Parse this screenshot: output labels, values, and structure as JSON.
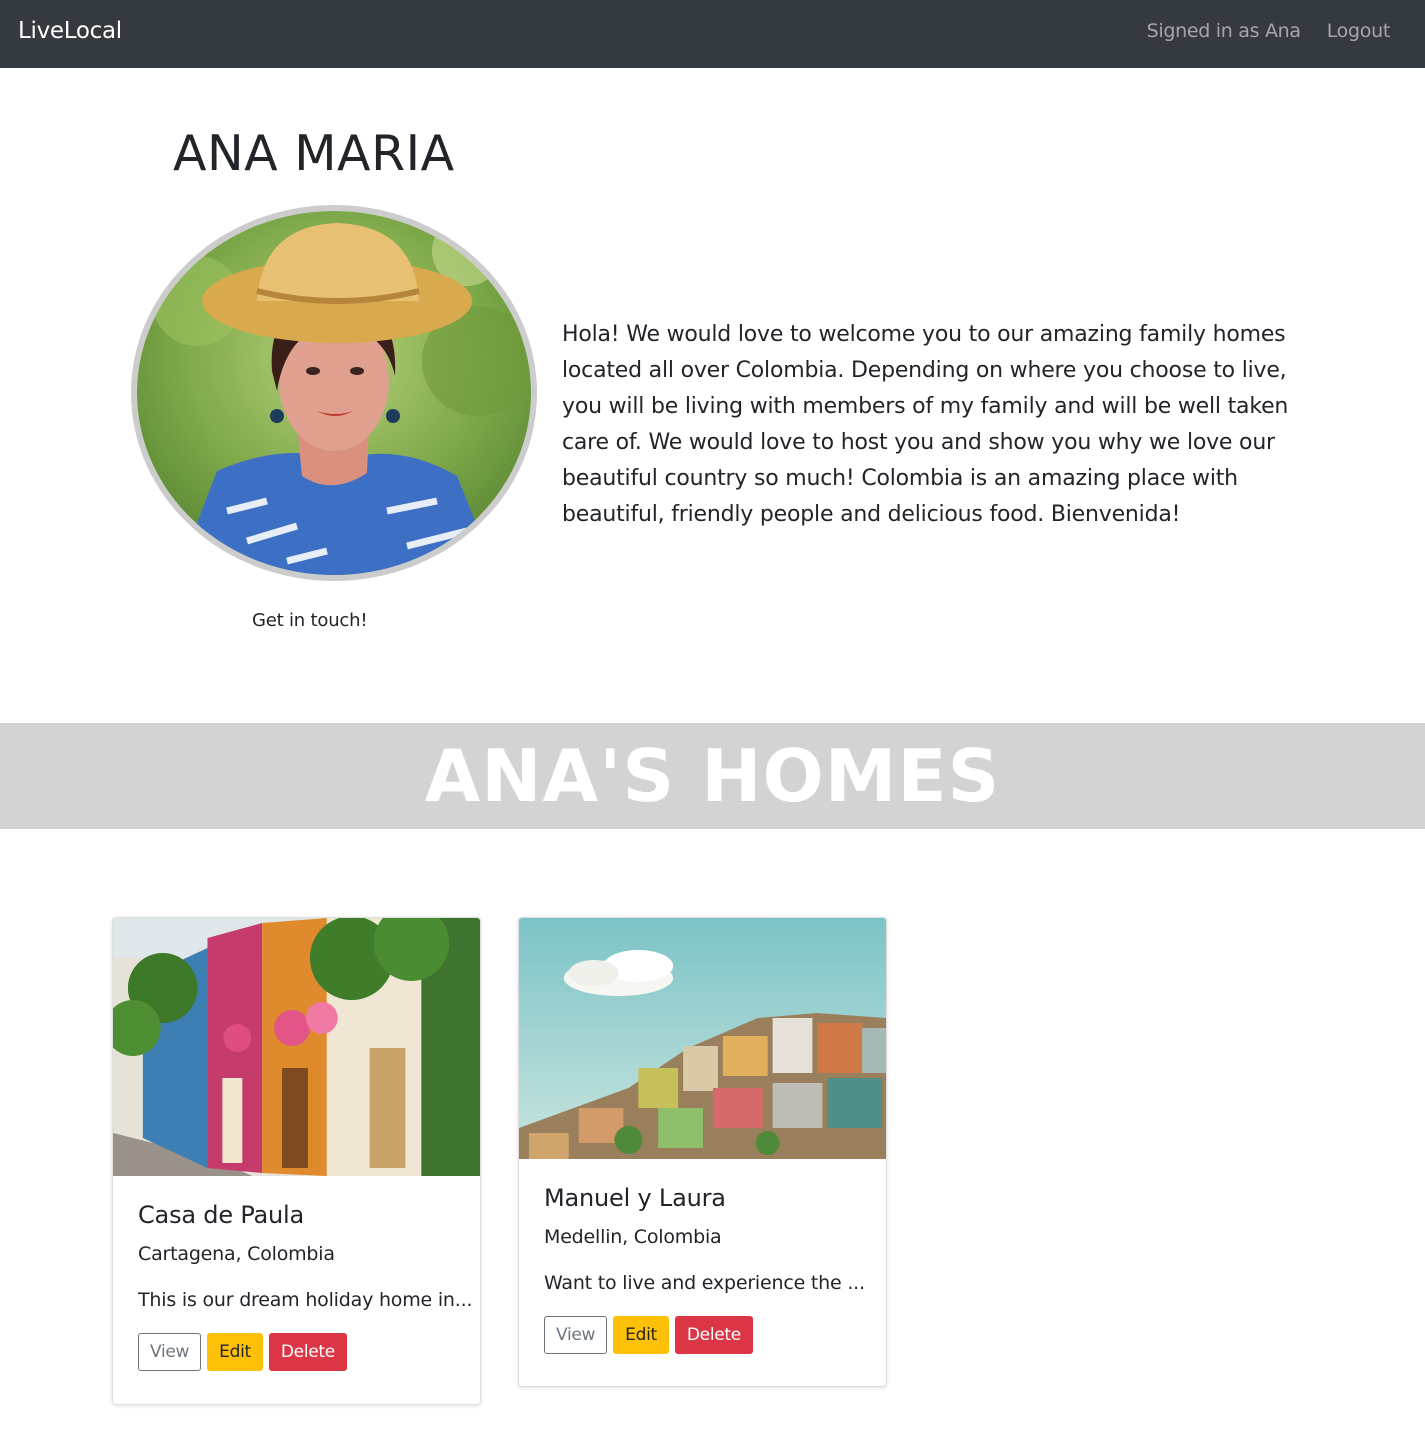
{
  "navbar": {
    "brand": "LiveLocal",
    "signed_in_text": "Signed in as Ana",
    "logout_label": "Logout"
  },
  "profile": {
    "name": "ANA MARIA",
    "bio": "Hola! We would love to welcome you to our amazing family homes located all over Colombia. Depending on where you choose to live, you will be living with members of my family and will be well taken care of. We would love to host you and show you why we love our beautiful country so much! Colombia is an amazing place with beautiful, friendly people and delicious food. Bienvenida!",
    "contact_label": "Get in touch!"
  },
  "homes_section": {
    "title": "ANA'S HOMES"
  },
  "homes": [
    {
      "title": "Casa de Paula",
      "location": "Cartagena, Colombia",
      "excerpt": "This is our dream holiday home in...",
      "view_label": "View",
      "edit_label": "Edit",
      "delete_label": "Delete"
    },
    {
      "title": "Manuel y Laura",
      "location": "Medellin, Colombia",
      "excerpt": "Want to live and experience the ...",
      "view_label": "View",
      "edit_label": "Edit",
      "delete_label": "Delete"
    }
  ],
  "colors": {
    "navbar_bg": "#343a40",
    "banner_bg": "#d3d3d3",
    "edit_button": "#ffc107",
    "delete_button": "#dc3545",
    "view_border": "#6c757d"
  }
}
